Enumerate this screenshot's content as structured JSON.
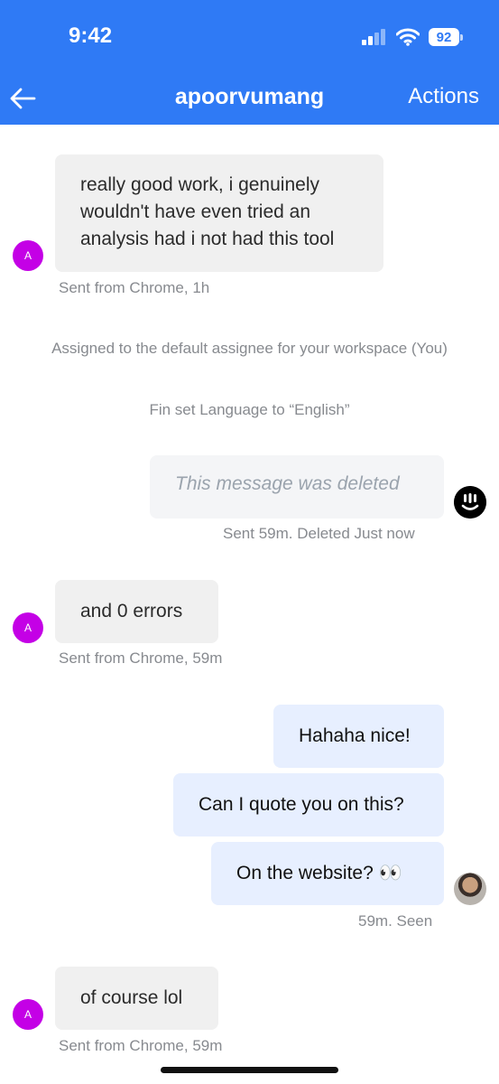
{
  "status_bar": {
    "time": "9:42",
    "battery": "92"
  },
  "header": {
    "title": "apoorvumang",
    "actions_label": "Actions"
  },
  "messages": [
    {
      "text": "really good work, i genuinely wouldn't have even tried an analysis had i not had this tool",
      "meta": "Sent from Chrome, 1h",
      "avatar": "A"
    },
    {
      "text": "This message was deleted",
      "meta": "Sent 59m. Deleted Just now"
    },
    {
      "text": "and 0 errors",
      "meta": "Sent from Chrome, 59m",
      "avatar": "A"
    },
    {
      "text": "Hahaha nice!"
    },
    {
      "text": "Can I quote you on this?"
    },
    {
      "text": "On the website? 👀",
      "meta": "59m. Seen"
    },
    {
      "text": "of course lol",
      "meta": "Sent from Chrome, 59m",
      "avatar": "A"
    }
  ],
  "system_events": [
    "Assigned to the default assignee for your workspace (You)",
    "Fin set Language to “English”"
  ],
  "colors": {
    "header": "#2f7af5",
    "avatar": "#c400e6",
    "outgoing_bubble": "#e7efff",
    "incoming_bubble": "#f0f0f0"
  }
}
